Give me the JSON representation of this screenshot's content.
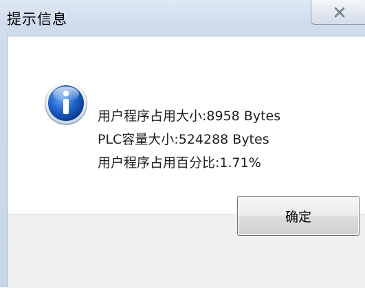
{
  "window": {
    "title": "提示信息",
    "close_icon": "close-icon"
  },
  "message": {
    "icon": "info-icon",
    "lines": [
      "用户程序占用大小:8958 Bytes",
      "PLC容量大小:524288 Bytes",
      "用户程序占用百分比:1.71%"
    ]
  },
  "buttons": {
    "ok_label": "确定"
  },
  "colors": {
    "icon_blue": "#1f5fc8",
    "footer_bg": "#f0f0f0"
  }
}
